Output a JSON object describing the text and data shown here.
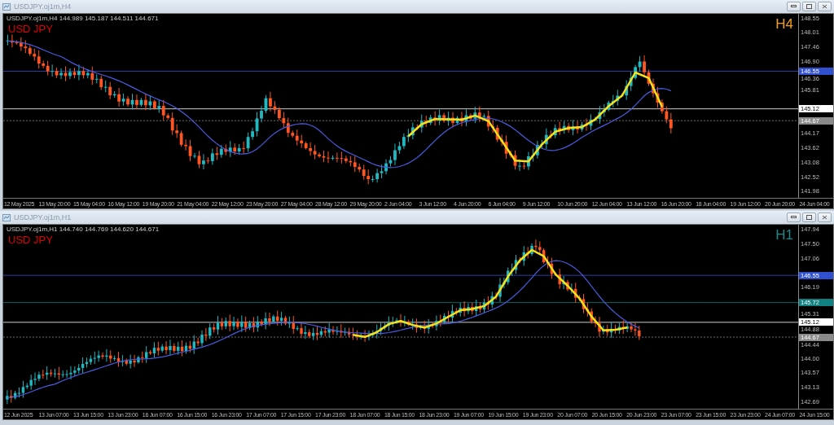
{
  "windows": [
    {
      "title": "USDJPY.oj1m,H4",
      "legend": "USDJPY.oj1m,H4  144.989 145.187 144.511 144.671",
      "symbol_label": "USD JPY",
      "timeframe": "H4",
      "color": "#f0a020",
      "price_ticks": [
        "148.55",
        "148.01",
        "147.46",
        "146.90",
        "146.36",
        "145.81",
        "144.17",
        "143.62",
        "143.08",
        "142.52",
        "141.98"
      ],
      "price_tags": [
        {
          "value": "146.55",
          "color": "#3050d0"
        },
        {
          "value": "145.12",
          "color": "#ffffff"
        },
        {
          "value": "144.67",
          "color": "#8a8a8a"
        }
      ],
      "time_labels": [
        "12 May 2025",
        "13 May 20:00",
        "15 May 04:00",
        "16 May 12:00",
        "19 May 20:00",
        "21 May 04:00",
        "22 May 12:00",
        "23 May 20:00",
        "27 May 04:00",
        "28 May 12:00",
        "29 May 20:00",
        "2 Jun 04:00",
        "3 Jun 12:00",
        "4 Jun 20:00",
        "6 Jun 04:00",
        "9 Jun 12:00",
        "10 Jun 20:00",
        "12 Jun 04:00",
        "13 Jun 12:00",
        "16 Jun 20:00",
        "18 Jun 04:00",
        "19 Jun 12:00",
        "20 Jun 20:00",
        "24 Jun 04:00"
      ]
    },
    {
      "title": "USDJPY.oj1m,H1",
      "legend": "USDJPY.oj1m,H1  144.740 144.769 144.620 144.671",
      "symbol_label": "USD JPY",
      "timeframe": "H1",
      "color": "#1a8a8a",
      "price_ticks": [
        "147.94",
        "147.50",
        "147.06",
        "146.19",
        "145.31",
        "144.88",
        "144.44",
        "144.00",
        "143.57",
        "143.13",
        "142.69"
      ],
      "price_tags": [
        {
          "value": "146.55",
          "color": "#3050d0"
        },
        {
          "value": "145.72",
          "color": "#108080"
        },
        {
          "value": "145.12",
          "color": "#ffffff"
        },
        {
          "value": "144.67",
          "color": "#8a8a8a"
        }
      ],
      "time_labels": [
        "12 Jun 2025",
        "13 Jun 07:00",
        "13 Jun 15:00",
        "13 Jun 23:00",
        "16 Jun 07:00",
        "16 Jun 15:00",
        "16 Jun 23:00",
        "17 Jun 07:00",
        "17 Jun 15:00",
        "17 Jun 23:00",
        "18 Jun 07:00",
        "18 Jun 15:00",
        "18 Jun 23:00",
        "19 Jun 07:00",
        "19 Jun 15:00",
        "19 Jun 23:00",
        "20 Jun 07:00",
        "20 Jun 15:00",
        "20 Jun 23:00",
        "23 Jun 07:00",
        "23 Jun 15:00",
        "23 Jun 23:00",
        "24 Jun 07:00",
        "24 Jun 15:00"
      ]
    }
  ]
}
